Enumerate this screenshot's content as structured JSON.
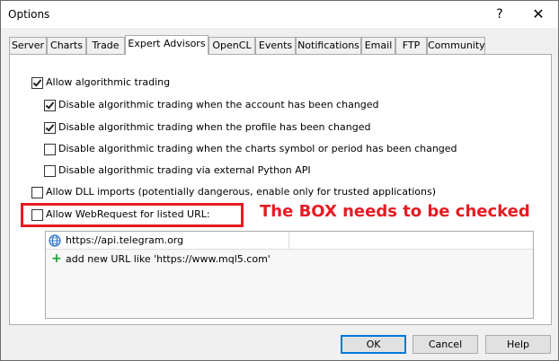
{
  "window": {
    "title": "Options",
    "help_label": "?",
    "close_label": "✕"
  },
  "tabs": [
    {
      "label": "Server"
    },
    {
      "label": "Charts"
    },
    {
      "label": "Trade"
    },
    {
      "label": "Expert Advisors",
      "active": true
    },
    {
      "label": "OpenCL"
    },
    {
      "label": "Events"
    },
    {
      "label": "Notifications"
    },
    {
      "label": "Email"
    },
    {
      "label": "FTP"
    },
    {
      "label": "Community"
    }
  ],
  "options": [
    {
      "label": "Allow algorithmic trading",
      "checked": true
    },
    {
      "label": "Disable algorithmic trading when the account has been changed",
      "checked": true
    },
    {
      "label": "Disable algorithmic trading when the profile has been changed",
      "checked": true
    },
    {
      "label": "Disable algorithmic trading when the charts symbol or period has been changed",
      "checked": false
    },
    {
      "label": "Disable algorithmic trading via external Python API",
      "checked": false
    },
    {
      "label": "Allow DLL imports (potentially dangerous, enable only for trusted applications)",
      "checked": false
    },
    {
      "label": "Allow WebRequest for listed URL:",
      "checked": false
    }
  ],
  "annotation": {
    "text": "The BOX needs to be checked",
    "color": "#e51b24"
  },
  "urls": {
    "entries": [
      "https://api.telegram.org"
    ],
    "add_label": "add new URL like 'https://www.mql5.com'",
    "entry_icon": "globe-icon",
    "add_icon": "plus-icon"
  },
  "buttons": {
    "ok": "OK",
    "cancel": "Cancel",
    "help": "Help"
  }
}
